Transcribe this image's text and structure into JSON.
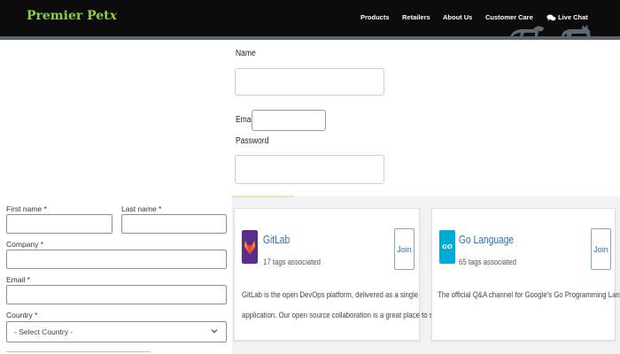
{
  "header": {
    "logo_text": "Premier Pet",
    "logo_tail": "x",
    "brand_color": "#8cd13c",
    "nav": [
      {
        "label": "Products"
      },
      {
        "label": "Retailers"
      },
      {
        "label": "About Us"
      },
      {
        "label": "Customer Care"
      },
      {
        "label": "Live Chat",
        "icon": "chat-bubbles-icon"
      }
    ]
  },
  "center_form": {
    "name_label": "Name",
    "email_label": "Email",
    "password_label": "Password"
  },
  "signup_form": {
    "first_name_label": "First name *",
    "last_name_label": "Last name *",
    "company_label": "Company *",
    "email_label": "Email *",
    "country_label": "Country *",
    "country_selected": "- Select Country -"
  },
  "cards": [
    {
      "title": "GitLab",
      "tags": "17 tags associated",
      "join_label": "Join",
      "description_lines": [
        "GitLab is the open DevOps platform, delivered as a single",
        "application. Our open source collaboration is a great place to sha..."
      ],
      "icon": "gitlab-logo-icon"
    },
    {
      "title": "Go Language",
      "tags": "65 tags associated",
      "join_label": "Join",
      "description_lines": [
        "The official Q&A channel for Google's Go Programming Language."
      ],
      "icon": "go-logo-icon",
      "icon_text": "GO"
    }
  ]
}
